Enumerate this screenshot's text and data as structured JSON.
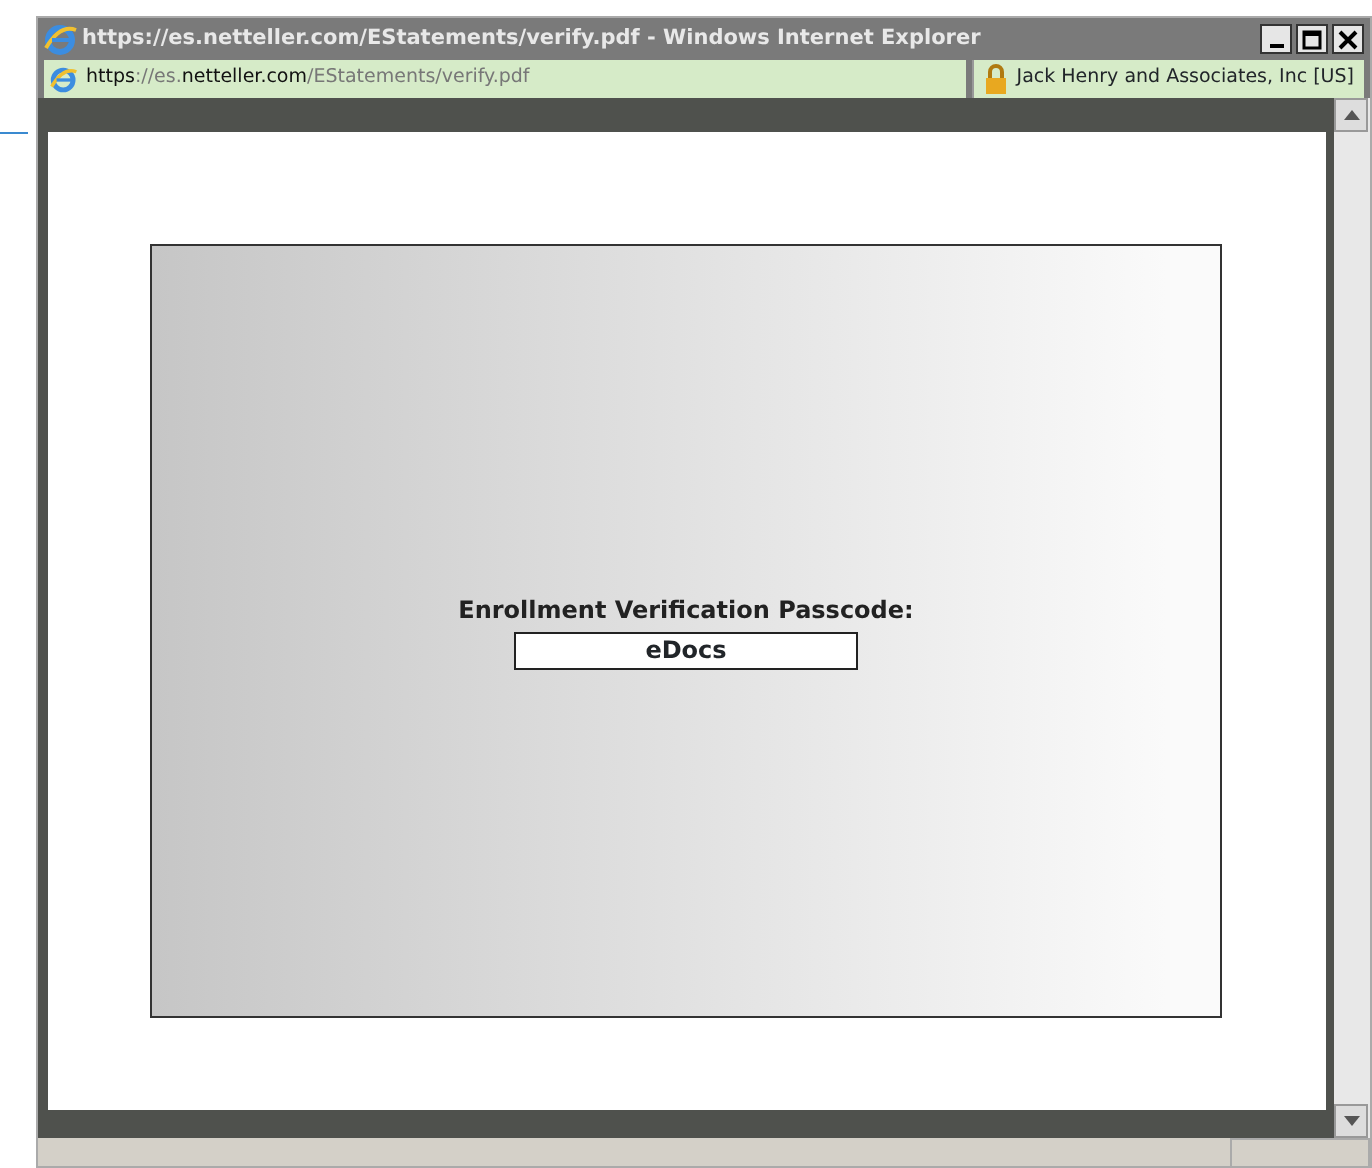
{
  "window": {
    "title": "https://es.netteller.com/EStatements/verify.pdf - Windows Internet Explorer"
  },
  "address_bar": {
    "url_parts": [
      {
        "text": "https",
        "strong": true
      },
      {
        "text": "://es.",
        "strong": false
      },
      {
        "text": "netteller.com",
        "strong": true
      },
      {
        "text": "/EStatements/verify.pdf",
        "strong": false
      }
    ],
    "certificate": "Jack Henry and Associates, Inc [US]"
  },
  "document": {
    "label": "Enrollment Verification Passcode:",
    "passcode": "eDocs"
  }
}
